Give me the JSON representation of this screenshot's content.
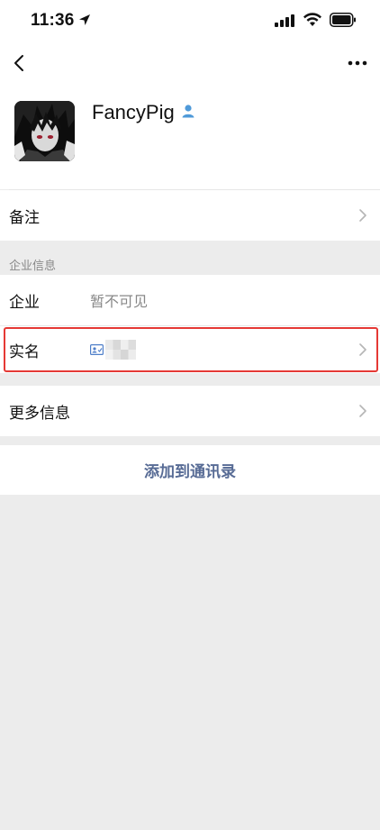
{
  "status_bar": {
    "time": "11:36"
  },
  "profile": {
    "name": "FancyPig"
  },
  "rows": {
    "remark": {
      "label": "备注"
    },
    "company": {
      "label": "企业",
      "value": "暂不可见"
    },
    "real_name": {
      "label": "实名"
    },
    "more_info": {
      "label": "更多信息"
    }
  },
  "sections": {
    "enterprise_header": "企业信息"
  },
  "actions": {
    "add_contact": "添加到通讯录"
  },
  "colors": {
    "accent_link": "#576b95",
    "highlight": "#e53935",
    "background": "#ececec"
  }
}
